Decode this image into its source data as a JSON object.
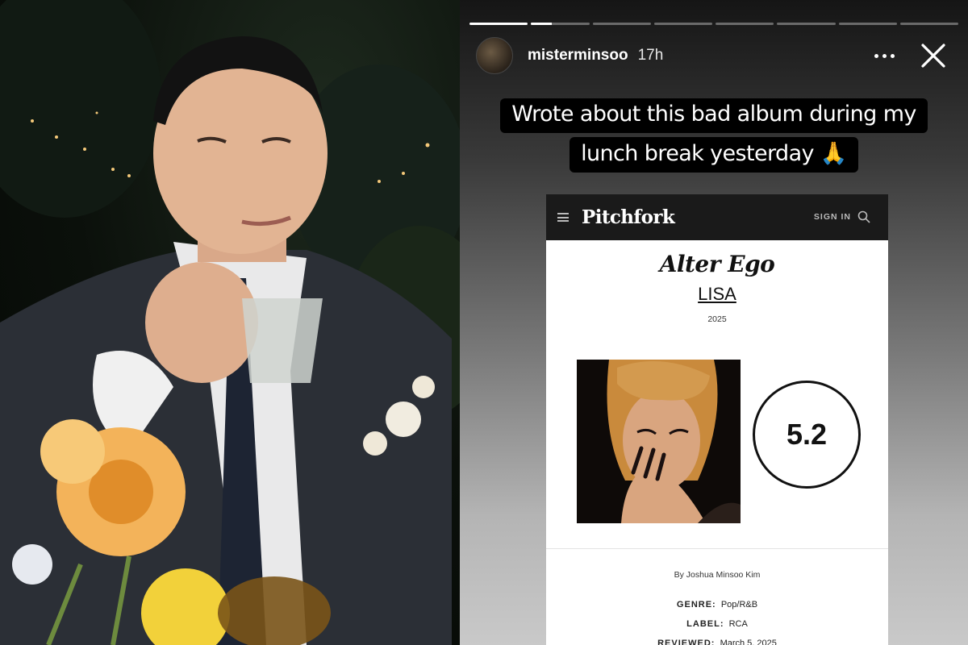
{
  "story": {
    "progress_segments": [
      1,
      0.35,
      0,
      0,
      0,
      0,
      0,
      0
    ],
    "username": "misterminsoo",
    "time_ago": "17h",
    "caption_lines": [
      "Wrote about this bad album during my",
      "lunch break yesterday 🙏"
    ],
    "icons": {
      "more": "more-options-icon",
      "close": "close-icon"
    }
  },
  "pitchfork": {
    "logo": "Pitchfork",
    "signin_label": "SIGN IN",
    "album_title": "Alter Ego",
    "artist": "LISA",
    "year": "2025",
    "score": "5.2",
    "byline": "By Joshua Minsoo Kim",
    "genre_label": "GENRE:",
    "genre_value": "Pop/R&B",
    "label_label": "LABEL:",
    "label_value": "RCA",
    "reviewed_label": "REVIEWED:",
    "reviewed_value": "March 5, 2025"
  },
  "colors": {
    "accent": "#ffffff",
    "pitchfork_bar": "#1a1a1a",
    "caption_bg": "#000000"
  }
}
